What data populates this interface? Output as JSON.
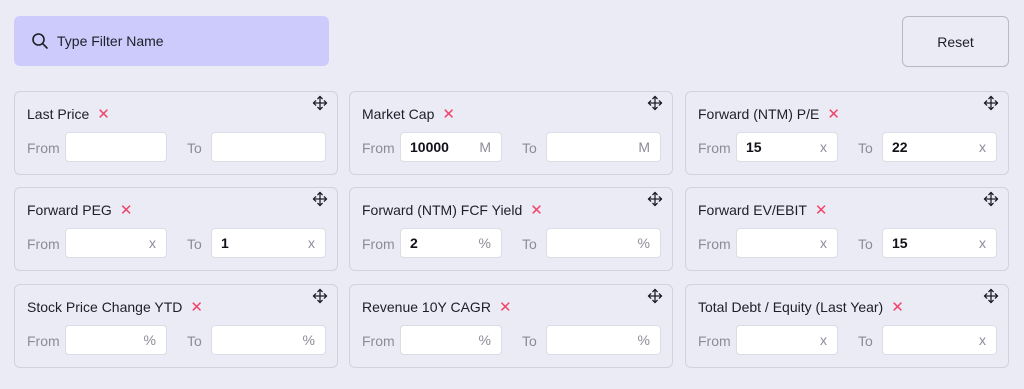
{
  "search": {
    "placeholder": "Type Filter Name"
  },
  "reset_label": "Reset",
  "labels": {
    "from": "From",
    "to": "To"
  },
  "icons": {
    "search": "search-icon",
    "remove": "close-x-icon",
    "move": "move-arrows-icon"
  },
  "colors": {
    "search_bg": "#cdcbfb",
    "remove": "#f0436a",
    "background": "#ebebf5"
  },
  "filters": [
    {
      "title": "Last Price",
      "from_value": "",
      "from_unit": "",
      "to_value": "",
      "to_unit": ""
    },
    {
      "title": "Market Cap",
      "from_value": "10000",
      "from_unit": "M",
      "to_value": "",
      "to_unit": "M"
    },
    {
      "title": "Forward (NTM) P/E",
      "from_value": "15",
      "from_unit": "x",
      "to_value": "22",
      "to_unit": "x"
    },
    {
      "title": "Forward PEG",
      "from_value": "",
      "from_unit": "x",
      "to_value": "1",
      "to_unit": "x"
    },
    {
      "title": "Forward (NTM) FCF Yield",
      "from_value": "2",
      "from_unit": "%",
      "to_value": "",
      "to_unit": "%"
    },
    {
      "title": "Forward EV/EBIT",
      "from_value": "",
      "from_unit": "x",
      "to_value": "15",
      "to_unit": "x"
    },
    {
      "title": "Stock Price Change YTD",
      "from_value": "",
      "from_unit": "%",
      "to_value": "",
      "to_unit": "%"
    },
    {
      "title": "Revenue 10Y CAGR",
      "from_value": "",
      "from_unit": "%",
      "to_value": "",
      "to_unit": "%"
    },
    {
      "title": "Total Debt / Equity (Last Year)",
      "from_value": "",
      "from_unit": "x",
      "to_value": "",
      "to_unit": "x"
    }
  ]
}
